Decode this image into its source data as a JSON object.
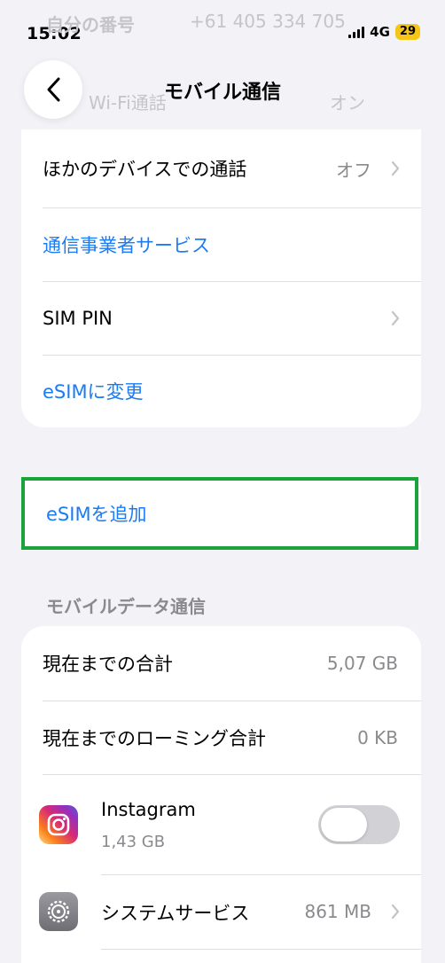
{
  "status": {
    "time": "15:02",
    "network": "4G",
    "battery": "29"
  },
  "ghost": {
    "top_label": "自分の番号",
    "top_value": "+61 405 334 705",
    "wifi_label": "Wi-Fi通話",
    "wifi_value": "オン"
  },
  "header": {
    "title": "モバイル通信",
    "back_icon": "chevron-left-icon"
  },
  "settings_card": {
    "other_devices_label": "ほかのデバイスでの通話",
    "other_devices_value": "オフ",
    "carrier_services": "通信事業者サービス",
    "sim_pin": "SIM PIN",
    "change_esim": "eSIMに変更"
  },
  "add_esim": {
    "label": "eSIMを追加",
    "highlight_color": "#1aa33a"
  },
  "mobile_data": {
    "section_title": "モバイルデータ通信",
    "total_label": "現在までの合計",
    "total_value": "5,07 GB",
    "roaming_label": "現在までのローミング合計",
    "roaming_value": "0 KB",
    "apps": [
      {
        "name": "Instagram",
        "usage": "1,43 GB",
        "icon": "instagram-icon",
        "enabled": false
      },
      {
        "name": "システムサービス",
        "usage": "861 MB",
        "icon": "gear-icon"
      }
    ]
  },
  "colors": {
    "accent": "#1a7cf5",
    "background": "#f2f2f7"
  }
}
